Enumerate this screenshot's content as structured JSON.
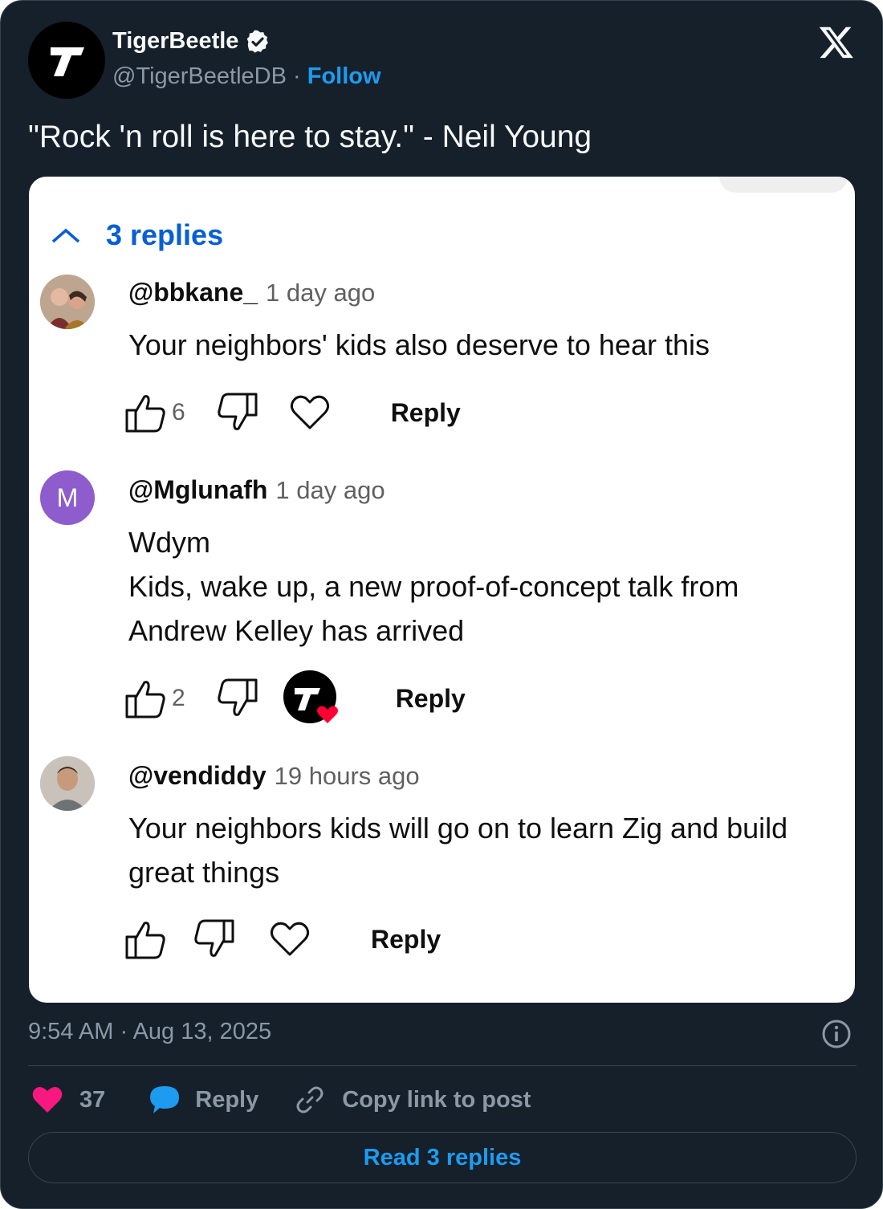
{
  "author": {
    "name": "TigerBeetle",
    "handle": "@TigerBeetleDB",
    "separator": "·",
    "follow_label": "Follow",
    "avatar_letter": "T",
    "verified": true
  },
  "tweet": {
    "text": "\"Rock 'n roll is here to stay.\" - Neil Young",
    "timestamp": "9:54 AM · Aug 13, 2025"
  },
  "embedded_screenshot": {
    "replies_toggle_label": "3 replies",
    "comments": [
      {
        "user": "@bbkane_",
        "time": "1 day ago",
        "lines": [
          "Your neighbors' kids also deserve to hear this"
        ],
        "likes": "6",
        "reply_label": "Reply",
        "creator_heart": false
      },
      {
        "user": "@Mglunafh",
        "time": "1 day ago",
        "avatar_letter": "M",
        "lines": [
          "Wdym",
          "Kids, wake up, a new proof-of-concept talk from",
          "Andrew Kelley has arrived"
        ],
        "likes": "2",
        "reply_label": "Reply",
        "creator_heart": true
      },
      {
        "user": "@vendiddy",
        "time": "19 hours ago",
        "lines": [
          "Your neighbors kids will go on to learn Zig and build",
          "great things"
        ],
        "likes": "",
        "reply_label": "Reply",
        "creator_heart": false
      }
    ]
  },
  "actions": {
    "likes": "37",
    "reply_label": "Reply",
    "copy_link_label": "Copy link to post",
    "read_replies_label": "Read 3 replies"
  },
  "colors": {
    "background": "#15202b",
    "accent": "#1d9bf0",
    "like": "#f91880",
    "yt_link": "#065fd4",
    "avatar_purple": "#8e5ccd"
  },
  "icons": [
    "x-logo-icon",
    "verified-badge-icon",
    "chevron-up-icon",
    "thumbs-up-icon",
    "thumbs-down-icon",
    "heart-outline-icon",
    "info-icon",
    "heart-icon",
    "reply-bubble-icon",
    "link-icon"
  ]
}
